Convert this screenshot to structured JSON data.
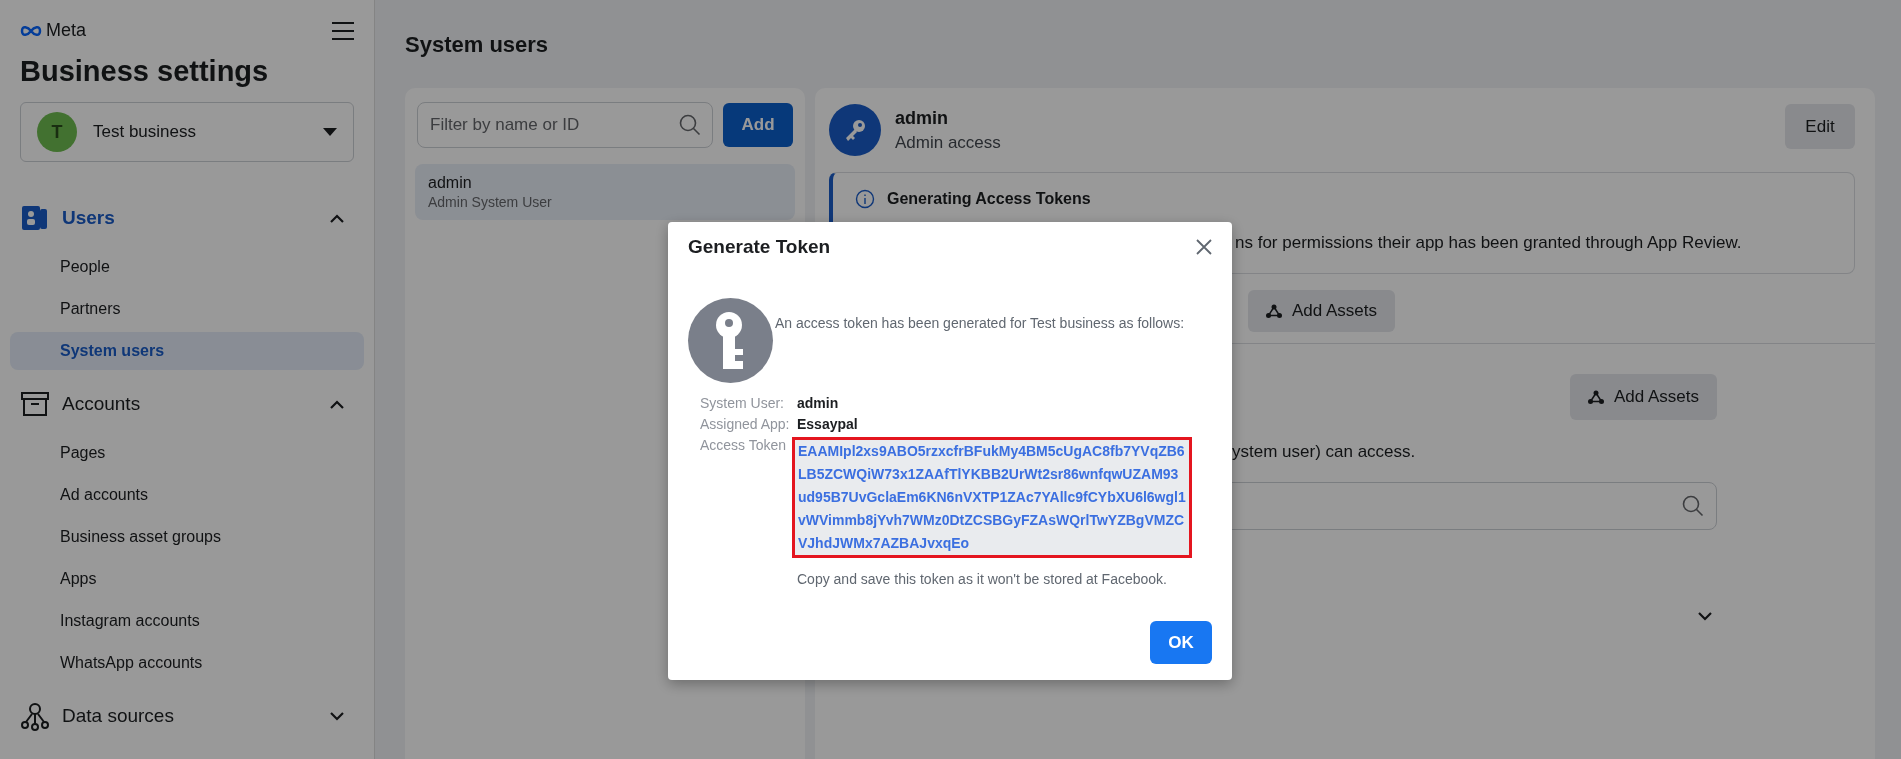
{
  "sidebar": {
    "logo": "Meta",
    "title": "Business settings",
    "business": {
      "initial": "T",
      "name": "Test business"
    },
    "sections": [
      {
        "label": "Users",
        "active": true,
        "expanded": true,
        "items": [
          {
            "label": "People",
            "selected": false
          },
          {
            "label": "Partners",
            "selected": false
          },
          {
            "label": "System users",
            "selected": true
          }
        ]
      },
      {
        "label": "Accounts",
        "active": false,
        "expanded": true,
        "items": [
          {
            "label": "Pages",
            "selected": false
          },
          {
            "label": "Ad accounts",
            "selected": false
          },
          {
            "label": "Business asset groups",
            "selected": false
          },
          {
            "label": "Apps",
            "selected": false
          },
          {
            "label": "Instagram accounts",
            "selected": false
          },
          {
            "label": "WhatsApp accounts",
            "selected": false
          }
        ]
      },
      {
        "label": "Data sources",
        "active": false,
        "expanded": false
      }
    ]
  },
  "page_title": "System users",
  "user_list": {
    "search": {
      "placeholder": "Filter by name or ID"
    },
    "add_button": "Add",
    "users": [
      {
        "name": "admin",
        "role": "Admin System User",
        "selected": true
      }
    ]
  },
  "user_detail": {
    "name": "admin",
    "subtitle": "Admin access",
    "edit_button": "Edit",
    "notice": {
      "title": "Generating Access Tokens",
      "text": "ns for permissions their app has been granted through App Review."
    },
    "add_assets_button": "Add Assets",
    "assets": {
      "add_assets_button": "Add Assets",
      "text": "ystem user) can access."
    }
  },
  "dialog": {
    "title": "Generate Token",
    "message": "An access token has been generated for Test business as follows:",
    "fields": [
      {
        "label": "System User:",
        "value": "admin"
      },
      {
        "label": "Assigned App:",
        "value": "Essaypal"
      }
    ],
    "token_label": "Access Token",
    "token": "EAAMIpl2xs9ABO5rzxcfrBFukMy4BM5cUgAC8fb7YVqZB6LB5ZCWQiW73x1ZAAfTlYKBB2UrWt2sr86wnfqwUZAM93ud95B7UvGclaEm6KN6nVXTP1ZAc7YAllc9fCYbXU6l6wgl1vWVimmb8jYvh7WMz0DtZCSBGyFZAsWQrlTwYZBgVMZCVJhdJWMx7AZBAJvxqEo",
    "note": "Copy and save this token as it won't be stored at Facebook.",
    "ok_button": "OK"
  }
}
